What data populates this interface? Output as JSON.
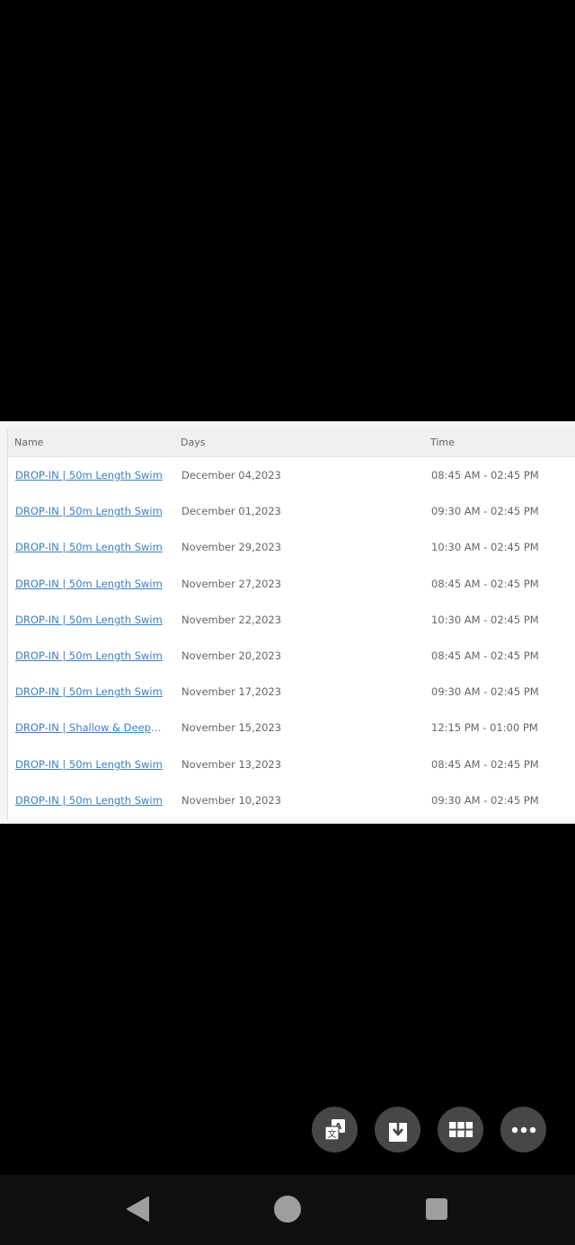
{
  "table": {
    "headers": {
      "name": "Name",
      "days": "Days",
      "time": "Time"
    },
    "rows": [
      {
        "name": "DROP-IN | 50m Length Swim",
        "days": "December 04,2023",
        "time": "08:45 AM - 02:45 PM"
      },
      {
        "name": "DROP-IN | 50m Length Swim",
        "days": "December 01,2023",
        "time": "09:30 AM - 02:45 PM"
      },
      {
        "name": "DROP-IN | 50m Length Swim",
        "days": "November 29,2023",
        "time": "10:30 AM - 02:45 PM"
      },
      {
        "name": "DROP-IN | 50m Length Swim",
        "days": "November 27,2023",
        "time": "08:45 AM - 02:45 PM"
      },
      {
        "name": "DROP-IN | 50m Length Swim",
        "days": "November 22,2023",
        "time": "10:30 AM - 02:45 PM"
      },
      {
        "name": "DROP-IN | 50m Length Swim",
        "days": "November 20,2023",
        "time": "08:45 AM - 02:45 PM"
      },
      {
        "name": "DROP-IN | 50m Length Swim",
        "days": "November 17,2023",
        "time": "09:30 AM - 02:45 PM"
      },
      {
        "name": "DROP-IN | Shallow & Deep A...",
        "days": "November 15,2023",
        "time": "12:15 PM - 01:00 PM"
      },
      {
        "name": "DROP-IN | 50m Length Swim",
        "days": "November 13,2023",
        "time": "08:45 AM - 02:45 PM"
      },
      {
        "name": "DROP-IN | 50m Length Swim",
        "days": "November 10,2023",
        "time": "09:30 AM - 02:45 PM"
      }
    ]
  },
  "fabs": [
    {
      "icon": "translate-icon"
    },
    {
      "icon": "download-icon"
    },
    {
      "icon": "grid-icon"
    },
    {
      "icon": "more-icon"
    }
  ],
  "navbar": {
    "back": "back-icon",
    "home": "home-icon",
    "recents": "recents-icon"
  },
  "colors": {
    "link": "#3d7fc0",
    "fab": "#474747",
    "navbar": "#12100e"
  }
}
